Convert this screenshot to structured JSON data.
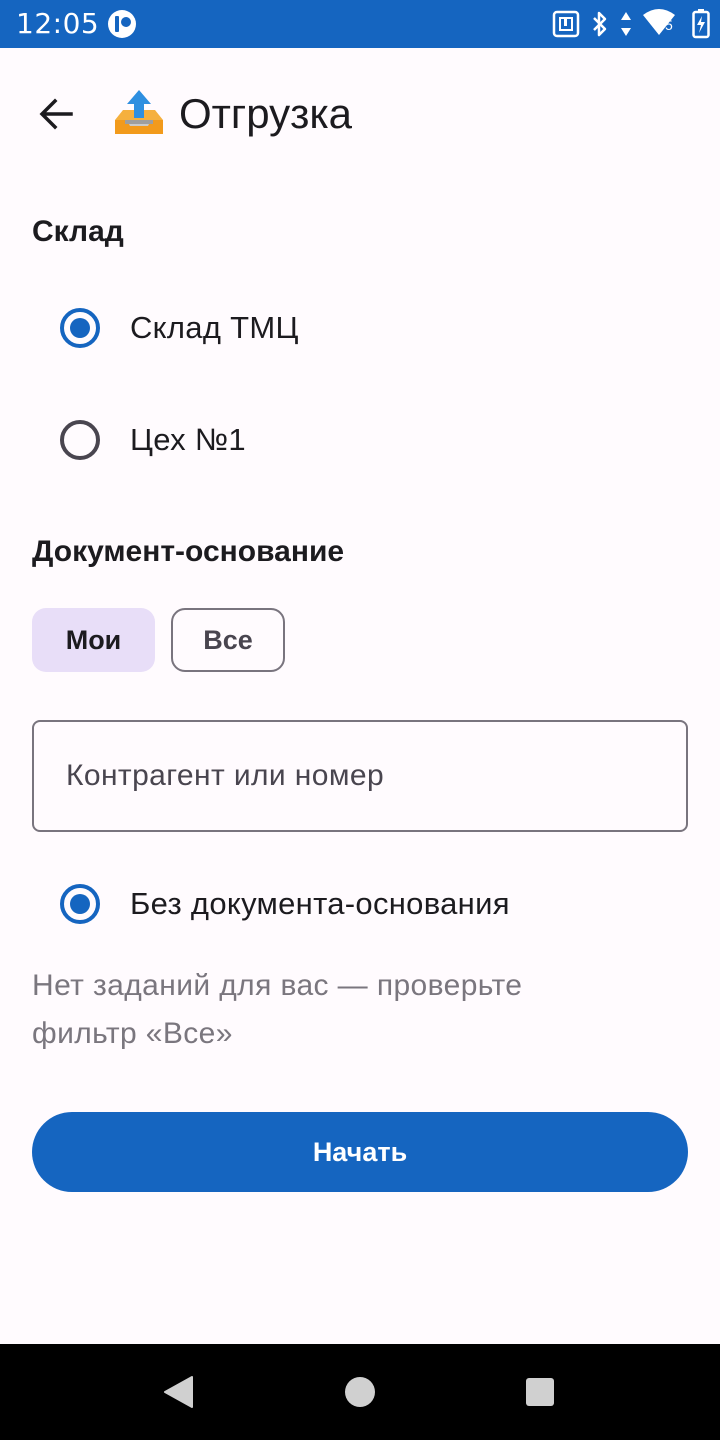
{
  "status_bar": {
    "time": "12:05",
    "network_badge": "5",
    "icons": [
      "app-notification-icon",
      "nfc-icon",
      "bluetooth-icon",
      "data-transfer-icon",
      "wifi-icon",
      "battery-charging-icon"
    ]
  },
  "app_bar": {
    "title": "Отгрузка",
    "back_icon": "arrow-back-icon",
    "title_icon": "outbox-tray-icon"
  },
  "warehouse": {
    "label": "Склад",
    "options": [
      {
        "label": "Склад ТМЦ",
        "selected": true
      },
      {
        "label": "Цех №1",
        "selected": false
      }
    ]
  },
  "document": {
    "label": "Документ-основание",
    "filters": [
      {
        "label": "Мои",
        "selected": true
      },
      {
        "label": "Все",
        "selected": false
      }
    ],
    "search": {
      "placeholder": "Контрагент или номер",
      "value": ""
    },
    "no_document_option": {
      "label": "Без документа-основания",
      "selected": true
    },
    "info": "Нет заданий для вас — проверьте фильтр «Все»"
  },
  "actions": {
    "start_label": "Начать"
  },
  "colors": {
    "primary": "#1565c0",
    "background": "#fffbfe",
    "chip_selected": "#e8def8",
    "hint_text": "#7a767e"
  },
  "nav_bar": {
    "buttons": [
      "back-triangle-icon",
      "home-circle-icon",
      "recents-square-icon"
    ]
  }
}
